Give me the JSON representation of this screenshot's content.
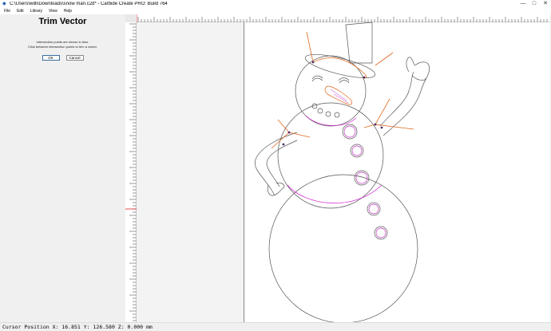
{
  "window": {
    "title": "C:\\Users\\willi\\Downloads\\snow man.c2d* - Carbide Create PRO: Build 764",
    "minimize": "—",
    "maximize": "□",
    "close": "✕"
  },
  "menu": {
    "items": [
      "File",
      "Edit",
      "Library",
      "View",
      "Help"
    ]
  },
  "panel": {
    "title": "Trim Vector",
    "info_line1": "Intersection points are shown in blue.",
    "info_line2": "Click between intersection points to trim a vector.",
    "ok_label": "OK",
    "cancel_label": "Cancel"
  },
  "status": {
    "cursor_text": "Cursor Position X: 16.851 Y: 126.580 Z: 0.000 mm"
  },
  "colors": {
    "outline": "#555555",
    "intersection": "#d020d0",
    "orange": "#e0661a",
    "canvas": "#ffffff"
  },
  "icons": {
    "app": "carbide-create-icon"
  }
}
